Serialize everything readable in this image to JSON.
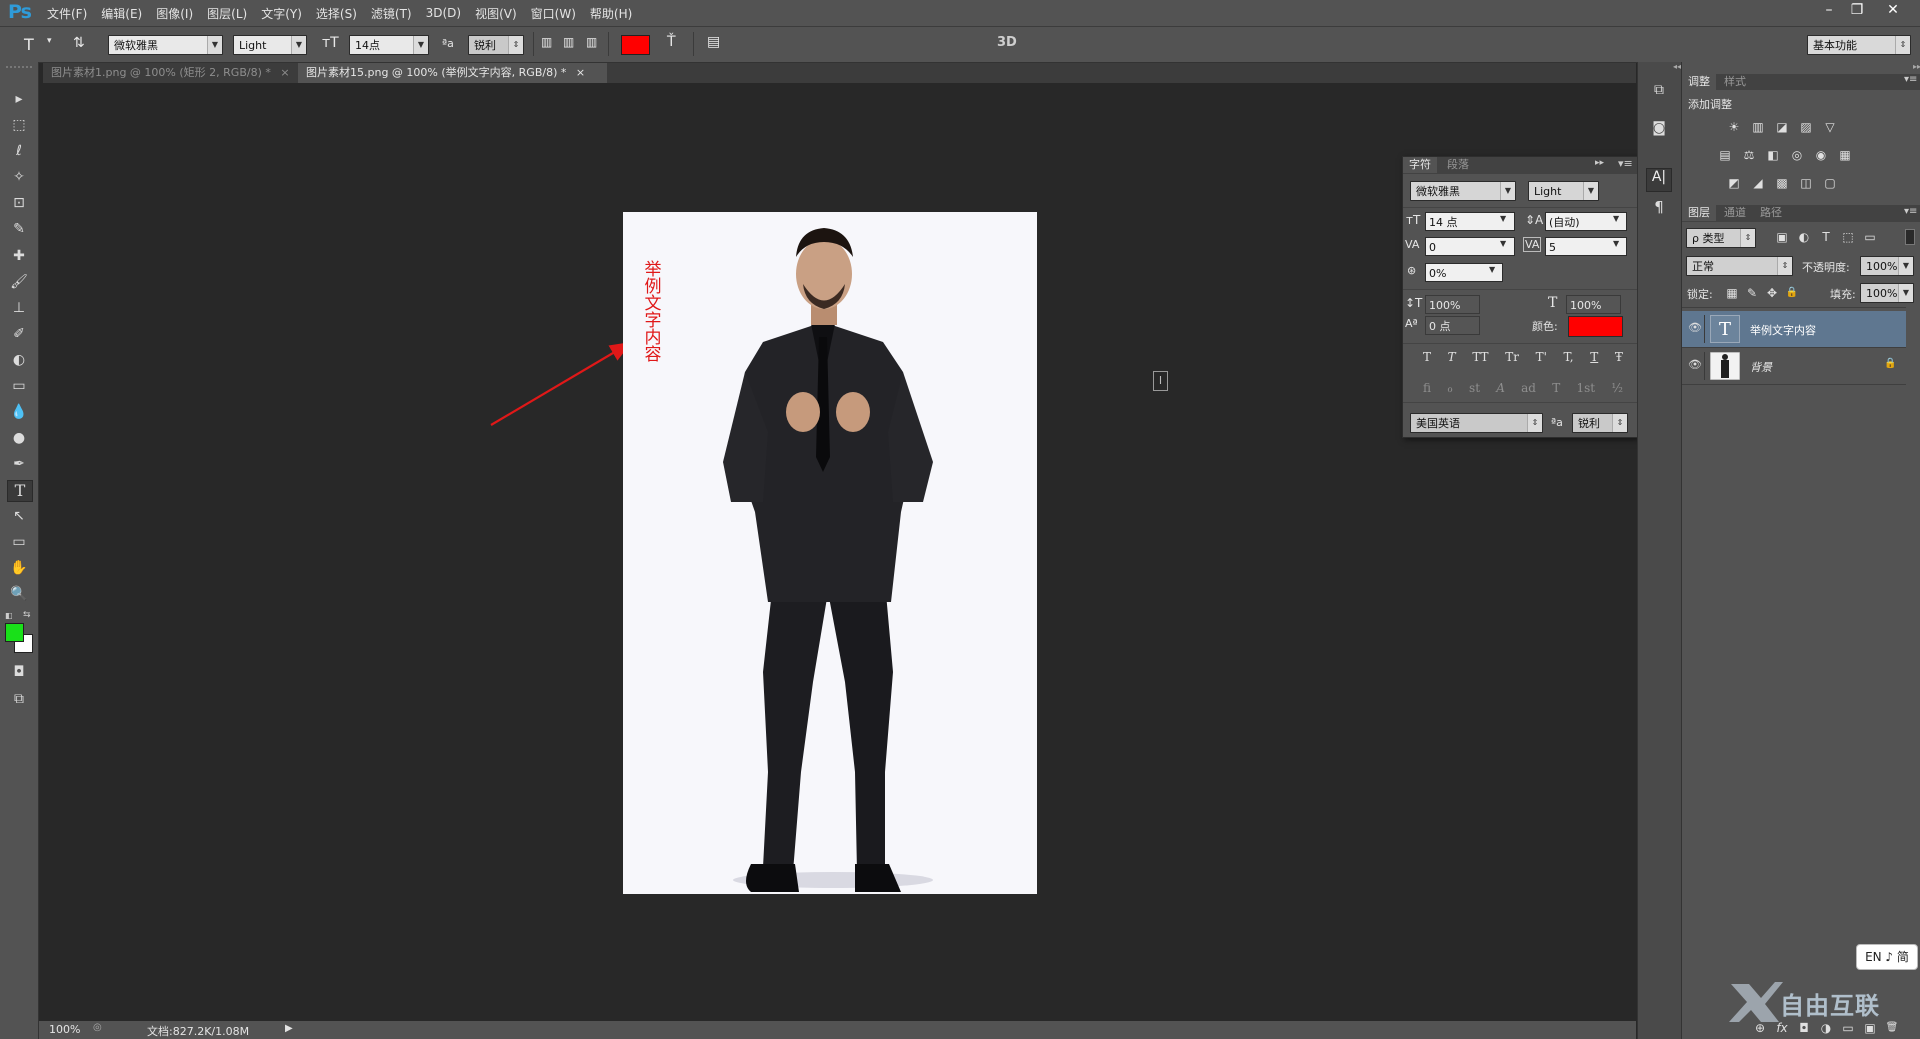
{
  "app": {
    "logo": "Ps"
  },
  "menu": [
    "文件(F)",
    "编辑(E)",
    "图像(I)",
    "图层(L)",
    "文字(Y)",
    "选择(S)",
    "滤镜(T)",
    "3D(D)",
    "视图(V)",
    "窗口(W)",
    "帮助(H)"
  ],
  "window_controls": {
    "minimize": "–",
    "restore": "❐",
    "close": "✕"
  },
  "options_bar": {
    "font_family": "微软雅黑",
    "font_style": "Light",
    "font_size": "14点",
    "aa_label": "ªa",
    "antialias": "锐利",
    "color_swatch": "#ff0000",
    "mode_3d": "3D",
    "workspace": "基本功能"
  },
  "tabs": [
    {
      "label": "图片素材1.png @ 100% (矩形 2, RGB/8) *",
      "close": "×",
      "active": false
    },
    {
      "label": "图片素材15.png @ 100% (举例文字内容, RGB/8) *",
      "close": "×",
      "active": true
    }
  ],
  "canvas": {
    "text_layer_content": "举例文字内容",
    "text_color": "#e01818",
    "arrow_color": "#e01818"
  },
  "status": {
    "zoom": "100%",
    "doc_info": "文档:827.2K/1.08M"
  },
  "colors": {
    "foreground": "#19e019",
    "background": "#ffffff"
  },
  "character_panel": {
    "tabs": [
      "字符",
      "段落"
    ],
    "font_family": "微软雅黑",
    "font_style": "Light",
    "size": "14 点",
    "leading": "(自动)",
    "kerning": "0",
    "tracking": "5",
    "tsume": "0%",
    "vertical_scale": "100%",
    "horizontal_scale": "100%",
    "baseline_shift": "0 点",
    "color_label": "颜色:",
    "color": "#ff0000",
    "style_buttons": [
      "T",
      "T",
      "TT",
      "Tr",
      "T'",
      "T,",
      "T",
      "Ŧ"
    ],
    "opentype_buttons": [
      "fi",
      "ℴ",
      "st",
      "A",
      "ad",
      "T",
      "1st",
      "½"
    ],
    "language": "美国英语",
    "aa_label": "ªa",
    "antialias": "锐利"
  },
  "adjustments_panel": {
    "tabs": [
      "调整",
      "样式"
    ],
    "title": "添加调整",
    "row1": [
      "☀",
      "▥",
      "◪",
      "▨",
      "▽"
    ],
    "row2": [
      "▤",
      "⚖",
      "◧",
      "◎",
      "◉",
      "▦"
    ],
    "row3": [
      "◩",
      "◢",
      "▩",
      "◫",
      "▢"
    ]
  },
  "layers_panel": {
    "tabs": [
      "图层",
      "通道",
      "路径"
    ],
    "filter": "ρ 类型",
    "filter_icons": [
      "▣",
      "◐",
      "T",
      "⬚",
      "▭"
    ],
    "blend_mode": "正常",
    "opacity_label": "不透明度:",
    "opacity": "100%",
    "lock_label": "锁定:",
    "lock_icons": [
      "▦",
      "✎",
      "✥",
      "🔒"
    ],
    "fill_label": "填充:",
    "fill": "100%",
    "layers": [
      {
        "name": "举例文字内容",
        "thumb": "T",
        "selected": true
      },
      {
        "name": "背景",
        "thumb": "",
        "selected": false
      }
    ],
    "bottom_icons": [
      "⊕",
      "fx",
      "◘",
      "◑",
      "▭",
      "▣",
      "🗑"
    ]
  },
  "ime": {
    "label": "EN ♪ 简"
  },
  "watermark": {
    "text": "自由互联"
  },
  "tools": [
    "▸",
    "⬚",
    "ℓ",
    "✧",
    "⊡",
    "✎",
    "✚",
    "🖌",
    "⊥",
    "✐",
    "◐",
    "▭",
    "💧",
    "●",
    "✒",
    "T",
    "↖",
    "▭",
    "✋",
    "🔍"
  ]
}
